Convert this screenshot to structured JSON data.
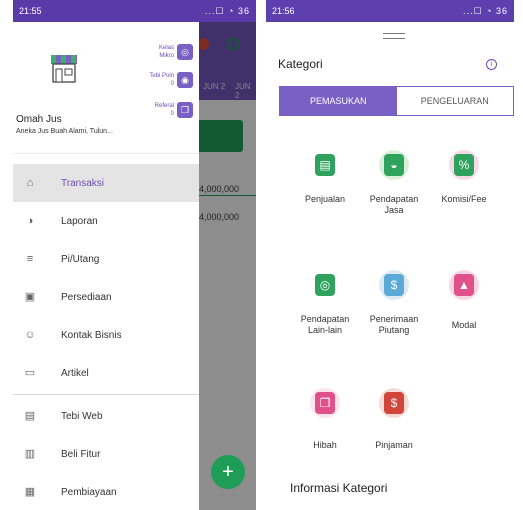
{
  "left_screen": {
    "status": {
      "time": "21:55",
      "icons": "...☐ ◔ 36"
    },
    "underlying": {
      "tabs": [
        "JUN 2",
        "JUN 2"
      ],
      "amounts": [
        "4,000,000",
        "4,000,000"
      ]
    },
    "fab_label": "+",
    "drawer": {
      "profile": {
        "name": "Omah Jus",
        "shop": "Aneka Jus Buah Alami, Tulun...",
        "stats": [
          {
            "label_line1": "Kelas",
            "label_line2": "Mikro",
            "icon": "medal-icon",
            "glyph": "◎"
          },
          {
            "label_line1": "Tebi Poin",
            "label_line2": "0",
            "icon": "coin-icon",
            "glyph": "◉"
          },
          {
            "label_line1": "Referal",
            "label_line2": "0",
            "icon": "gift-icon",
            "glyph": "❐"
          }
        ]
      },
      "menu": [
        {
          "id": "transaksi",
          "label": "Transaksi",
          "icon": "store-icon",
          "glyph": "⌂",
          "active": true
        },
        {
          "id": "laporan",
          "label": "Laporan",
          "icon": "pie-chart-icon",
          "glyph": "◑",
          "active": false
        },
        {
          "id": "pi-utang",
          "label": "Pi/Utang",
          "icon": "debt-icon",
          "glyph": "≡",
          "active": false
        },
        {
          "id": "persediaan",
          "label": "Persediaan",
          "icon": "box-icon",
          "glyph": "▣",
          "active": false
        },
        {
          "id": "kontak-bisnis",
          "label": "Kontak Bisnis",
          "icon": "person-icon",
          "glyph": "☺",
          "active": false
        },
        {
          "id": "artikel",
          "label": "Artikel",
          "icon": "book-icon",
          "glyph": "▭",
          "active": false
        }
      ],
      "menu2": [
        {
          "id": "tebi-web",
          "label": "Tebi Web",
          "icon": "web-icon",
          "glyph": "▤"
        },
        {
          "id": "beli-fitur",
          "label": "Beli Fitur",
          "icon": "bag-icon",
          "glyph": "▥"
        },
        {
          "id": "pembiayaan",
          "label": "Pembiayaan",
          "icon": "finance-icon",
          "glyph": "▦"
        }
      ]
    }
  },
  "right_screen": {
    "status": {
      "time": "21:56",
      "icons": "...☐ ◔ 36"
    },
    "title": "Kategori",
    "tabs": {
      "active": "PEMASUKAN",
      "inactive": "PENGELUARAN"
    },
    "categories": [
      {
        "line1": "Penjualan",
        "line2": "",
        "icon": "pos-terminal-icon",
        "glyph": "▤",
        "color": "#2fa35d",
        "bg": "#ffffff"
      },
      {
        "line1": "Pendapatan",
        "line2": "Jasa",
        "icon": "service-tray-icon",
        "glyph": "◒",
        "color": "#2fa35d",
        "bg": "#d8f0d8"
      },
      {
        "line1": "Komisi/Fee",
        "line2": "",
        "icon": "commission-heart-icon",
        "glyph": "%",
        "color": "#2fa35d",
        "bg": "#f5d9e6"
      },
      {
        "line1": "Pendapatan",
        "line2": "Lain-lain",
        "icon": "coins-icon",
        "glyph": "◎",
        "color": "#2fa35d",
        "bg": "#ffffff"
      },
      {
        "line1": "Penerimaan",
        "line2": "Piutang",
        "icon": "receive-money-icon",
        "glyph": "$",
        "color": "#5aa9d6",
        "bg": "#dde9f5"
      },
      {
        "line1": "Modal",
        "line2": "",
        "icon": "gold-bars-icon",
        "glyph": "▲",
        "color": "#e0508a",
        "bg": "#f7d5e4"
      },
      {
        "line1": "Hibah",
        "line2": "",
        "icon": "gift-box-icon",
        "glyph": "❐",
        "color": "#e0508a",
        "bg": "#fbe4ec"
      },
      {
        "line1": "Pinjaman",
        "line2": "",
        "icon": "loan-hand-icon",
        "glyph": "$",
        "color": "#d2453b",
        "bg": "#f5dcd8"
      }
    ],
    "section_title": "Informasi Kategori",
    "info_glyph": "i"
  }
}
